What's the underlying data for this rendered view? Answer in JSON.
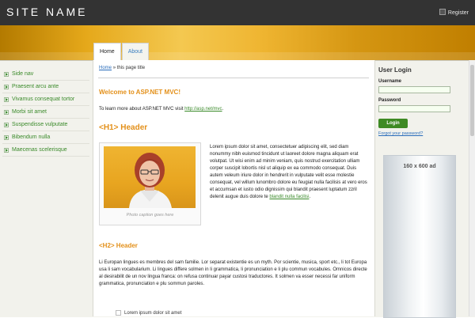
{
  "header": {
    "site_name": "SITE NAME",
    "register_label": "Register"
  },
  "tabs": [
    {
      "label": "Home"
    },
    {
      "label": "About"
    }
  ],
  "left_nav": {
    "items": [
      {
        "label": "Side nav"
      },
      {
        "label": "Praesent arcu ante"
      },
      {
        "label": "Vivamus consequat tortor"
      },
      {
        "label": "Morbi sit amet"
      },
      {
        "label": "Suspendisse vulputate"
      },
      {
        "label": "Bibendum nulla"
      },
      {
        "label": "Maecenas scelerisque"
      }
    ]
  },
  "breadcrumb": {
    "home": "Home",
    "separator": "»",
    "current": "this page title"
  },
  "content": {
    "welcome": "Welcome to ASP.NET MVC!",
    "intro_text": "To learn more about ASP.NET MVC visit",
    "intro_link": "http://asp.net/mvc",
    "intro_end": ".",
    "h1": "<H1> Header",
    "photo_caption": "Photo caption goes here",
    "lorem_text": "Lorem ipsum dolor sit amet, consectetuer adipiscing elit, sed diam nonummy nibh euismod tincidunt ut laoreet dolore magna aliquam erat volutpat. Ut wisi enim ad minim veniam, quis nostrud exercitation ulliam corper suscipit lobortis nisl ut aliquip ex ea commodo consequat. Duis autem veleum iriure dolor in hendrerit in vulputate velit esse molestie consequat, vel willum lunombro dolore eu feugiat nulla facilisis at vero eros et accumsan et iusto odio dignissim qui blandit praesent luptatum zzril delenit augue duis dolore te",
    "lorem_link": "blandit nulla facilisi",
    "lorem_end": ".",
    "h2": "<H2> Header",
    "paragraph2": "Li Europan lingues es membres del sam familie. Lor separat existentie es un myth. Por scientie, musica, sport etc., li tot Europa usa li sam vocabularium. Li lingues differe solmen in li grammatica, li pronunciation e li plu commun vocabules. Omnicos directe al desirabilit de un nov lingua franca: on refusa continuar payar custosi traductores. It solmen va esser necessi far uniform grammatica, pronunciation e plu sommun paroles.",
    "list_item": "Lorem ipsum dolor sit amet"
  },
  "sidebar": {
    "title": "User Login",
    "username_label": "Username",
    "password_label": "Password",
    "login_button": "Login",
    "forgot_link": "Forgot your password?",
    "ad_label": "160 x 600 ad"
  },
  "colors": {
    "accent_orange": "#e3901a",
    "link_green": "#3a8a2a",
    "button_green": "#3e8a24",
    "header_dark": "#333333"
  }
}
